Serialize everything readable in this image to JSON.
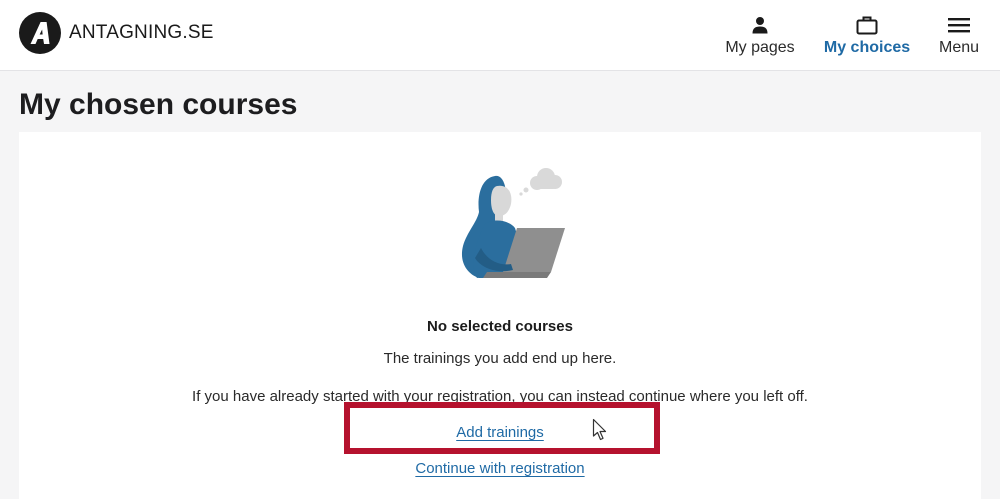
{
  "header": {
    "logo_text": "ANTAGNING.SE",
    "logo_letter": "A",
    "nav": [
      {
        "label": "My pages",
        "icon": "person-icon",
        "active": false
      },
      {
        "label": "My choices",
        "icon": "briefcase-icon",
        "active": true
      },
      {
        "label": "Menu",
        "icon": "hamburger-menu-icon",
        "active": false
      }
    ]
  },
  "main": {
    "title": "My chosen courses",
    "empty_state": {
      "illustration": "person-with-laptop-illustration",
      "title": "No selected courses",
      "subtitle": "The trainings you add end up here.",
      "info": "If you have already started with your registration, you can instead continue where you left off.",
      "primary_link": "Add trainings",
      "secondary_link": "Continue with registration"
    }
  },
  "colors": {
    "accent": "#1f6aa5",
    "highlight": "#b5122e",
    "illustration_blue": "#2b6e9e"
  }
}
